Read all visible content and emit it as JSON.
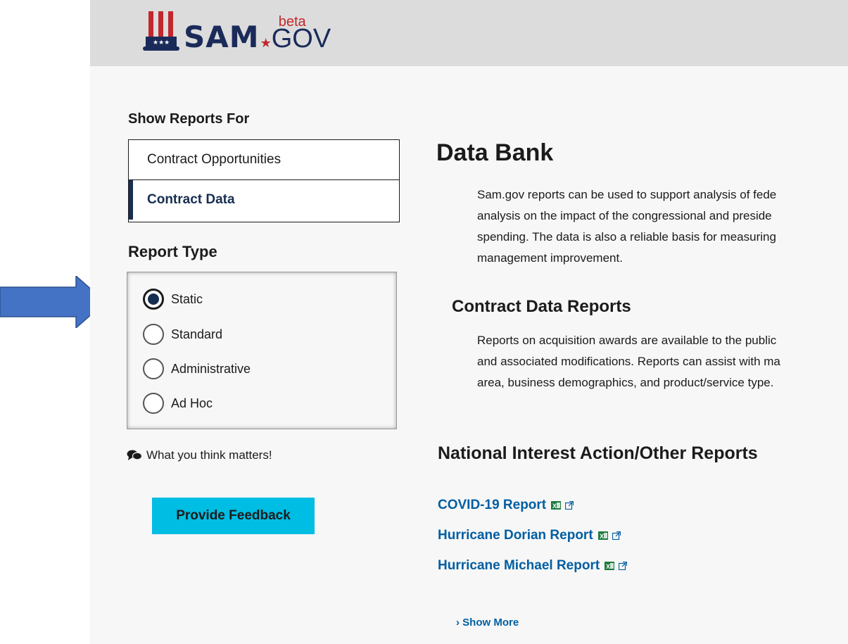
{
  "brand": {
    "logo_text": "SAM",
    "beta": "beta",
    "gov": "GOV"
  },
  "sidebar": {
    "show_reports_title": "Show Reports For",
    "report_for": [
      {
        "label": "Contract Opportunities",
        "active": false
      },
      {
        "label": "Contract Data",
        "active": true
      }
    ],
    "report_type_title": "Report Type",
    "report_types": [
      {
        "label": "Static",
        "selected": true
      },
      {
        "label": "Standard",
        "selected": false
      },
      {
        "label": "Administrative",
        "selected": false
      },
      {
        "label": "Ad Hoc",
        "selected": false
      }
    ],
    "feedback_prompt": "What you think matters!",
    "feedback_button": "Provide Feedback"
  },
  "main": {
    "title": "Data Bank",
    "intro_lines": [
      "Sam.gov reports can be used to support analysis of fede",
      "analysis on the impact of the congressional and preside",
      "spending. The data is also a reliable basis for measuring",
      "management improvement."
    ],
    "section_title": "Contract Data Reports",
    "section_lines": [
      "Reports on acquisition awards are available to the public",
      "and associated modifications. Reports can assist with ma",
      "area, business demographics, and product/service type."
    ],
    "nia_title": "National Interest Action/Other Reports",
    "reports": [
      {
        "label": "COVID-19 Report"
      },
      {
        "label": "Hurricane Dorian Report"
      },
      {
        "label": "Hurricane Michael Report"
      }
    ],
    "show_more": "Show More"
  },
  "colors": {
    "header_bg": "#dcdcdc",
    "navy": "#162e51",
    "link": "#005ea2",
    "button": "#00bde3",
    "arrow": "#4472c4",
    "logo_red": "#c2272d"
  },
  "icons": {
    "chat": "chat-bubbles-icon",
    "excel": "excel-icon",
    "external": "external-link-icon",
    "arrow": "right-arrow-annotation"
  }
}
